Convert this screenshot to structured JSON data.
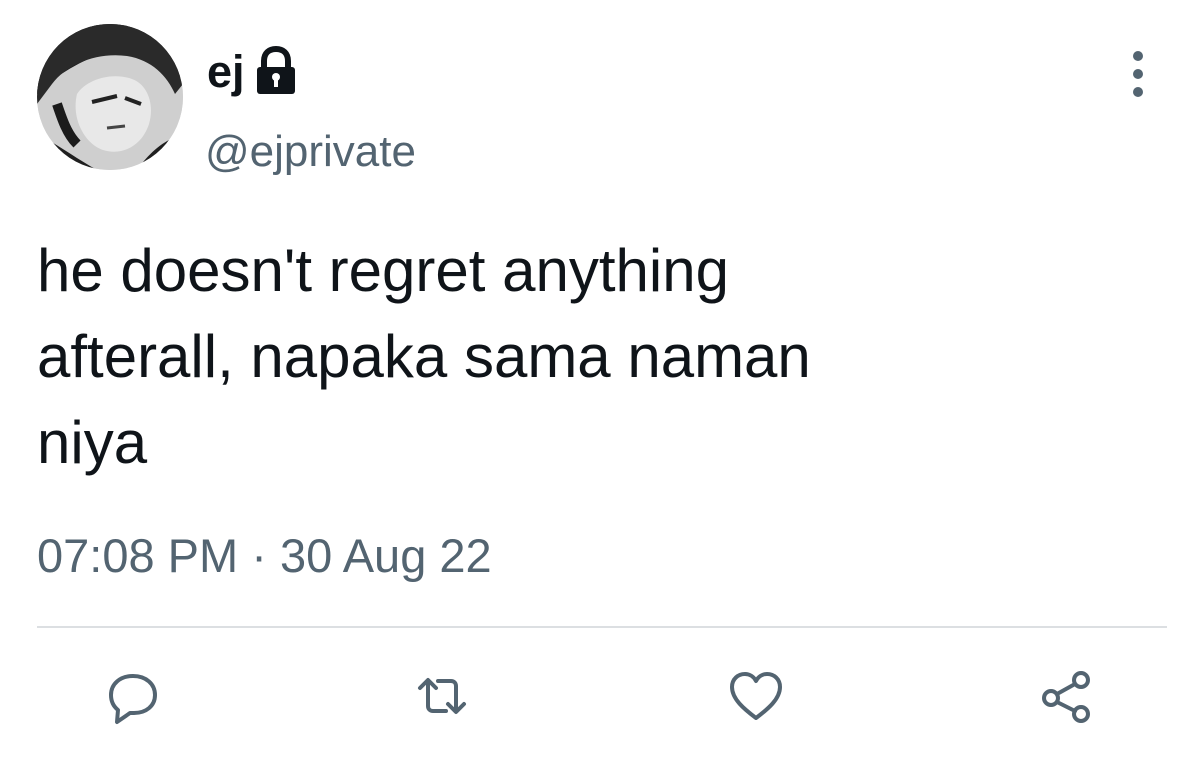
{
  "tweet": {
    "display_name": "ej",
    "handle": "@ejprivate",
    "text": "he doesn't regret anything\nafterall, napaka sama naman\nniya",
    "time": "07:08 PM",
    "separator": "·",
    "date": "30 Aug 22"
  },
  "icons": {
    "avatar": "avatar-image",
    "lock": "lock-icon",
    "more": "more-vertical-icon",
    "reply": "reply-icon",
    "retweet": "retweet-icon",
    "like": "heart-icon",
    "share": "share-icon"
  },
  "colors": {
    "text_primary": "#0f1419",
    "text_secondary": "#536471",
    "divider": "#dcdfe2"
  }
}
